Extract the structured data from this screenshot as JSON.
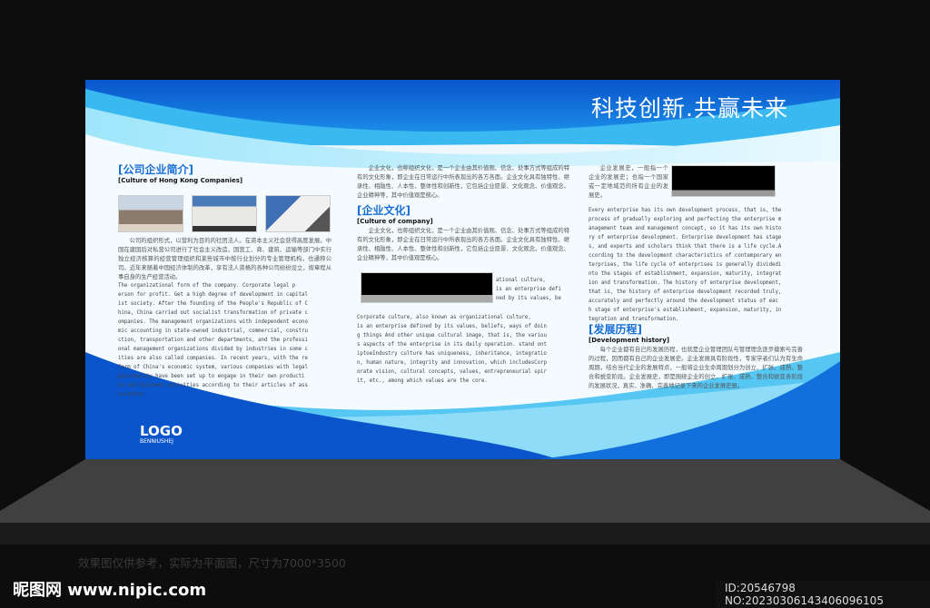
{
  "slogan": "科技创新.共赢未来",
  "logo": {
    "text": "LOGO",
    "sub": "BENNIUSHEJ"
  },
  "section1": {
    "title": "[公司企业简介]",
    "subtitle": "[Culture of Hong Kong Companies]",
    "cn": "公司的组织形式，以营利为目的的社团法人。在资本主义社会获得高度发展。中国在建国后对私营公司进行了社会主义改造，国营工、商、建筑、运输等部门中实行独立经济核算的经营管理组织和某些城市中按行业划分的专业管理机构，也通称公司。近年来随着中国经济体制的改革，享有法人资格的各种公司纷纷设立，按章程从事自身的生产经营活动。",
    "en": "    The organizational form of the company. Corporate legal p\nerson for profit. Get a high degree of development in capital\nist society. After the founding of the People's Republic of C\nhina, China carried out socialist transformation of private c\nompanies. The management organizations with independent econo\nmic accounting in state-owned industrial, commercial, constru\nction, transportation and other departments, and the professi\nonal management organizations divided by industries in some c\nities are also called companies. In recent years, with the re\nform of China's economic system, various companies with legal\n personality have been set up to engage in their own producti\non and business activities according to their articles of ass\nociation."
  },
  "section2": {
    "intro_cn": "企业文化，也称组织文化，是一个企业由其价值观、信念、处事方式等组成的特有的文化形象，即企业在日常运行中所表现出的各方各面。企业文化具有独特性、继承性、相融性、人本性、整体性和创新性，它包括企业愿景、文化观念、价值观念、企业精神等，其中价值观是核心。",
    "title": "[企业文化]",
    "subtitle": "[Culture of company]",
    "cn": "企业文化，也称组织文化，是一个企业由其价值观、信念、处事方式等组成的特有的文化形象，即企业在日常运行中所表现出的各方各面。企业文化具有独特性、继承性、相融性、人本性、整体性和创新性，它包括企业愿景、文化观念、价值观念、企业精神等，其中价值观是核心。",
    "side_en": "ational culture,\nis an enterprise defi\nned by its values, be",
    "en": "    Corporate culture, also known as organizational culture,\nis an enterprise defined by its values, beliefs, ways of doin\ng things And other unique cultural image, that is, the variou\ns aspects of the enterprise in its daily operation. stand ont\niptoeIndustry culture has uniqueness, inheritance, integratio\nn, human nature, integrity and innovation, which includesCorp\norate vision, cultural concepts, values, entrepreneurial spir\nit, etc., among which values are the core."
  },
  "section3": {
    "side_cn": "企业发展史，一般指一个企业的发展史；也指一个国家或一定地域范的所有企业的发展史。",
    "en": "Every enterprise has its own development process, that is, the\nprocess of gradually exploring and perfecting the enterprise m\nanagement team and management concept, so it has its own histo\nry of enterprise development. Enterprise development has stage\ns, and experts and scholars think that there is a life cycle.A\nccording to the development characteristics of contemporary en\nterprises, the life cycle of enterprises is generally dividedi\nnto the stages of establishment, expansion, maturity, integrat\nion and transformation. The history of enterprise development,\nthat is, the history of enterprise development recorded truly,\n accurately and perfectly around the development status of eac\nh stage of enterprise's establishment, expansion, maturity, in\ntegration and transformation.",
    "title": "[发展历程]",
    "subtitle": "[Development history]",
    "cn": "每个企业都有自己的发展历程，也就是企业管理团队与管理理念逐步摸索与完善的过程，因而都有自己的企业发展史。企业发展具有阶段性，专家学者们认为有生命周期，结合当代企业的发展特点，一般将企业生命周期划分为创立、扩张、成熟、整合和蜕变阶段。企业发展史，即是围绕企业的创立、扩张、成熟、整合和蜕变各阶段的发展状况，真实、准确、完善地记录下来的企业发展史册。"
  },
  "footer": {
    "note": "效果图仅供参考，实际为平面图，尺寸为7000*3500",
    "watermark": "昵图网 www.nipic.com",
    "id": "ID:20546798 NO:20230306143406096105"
  }
}
